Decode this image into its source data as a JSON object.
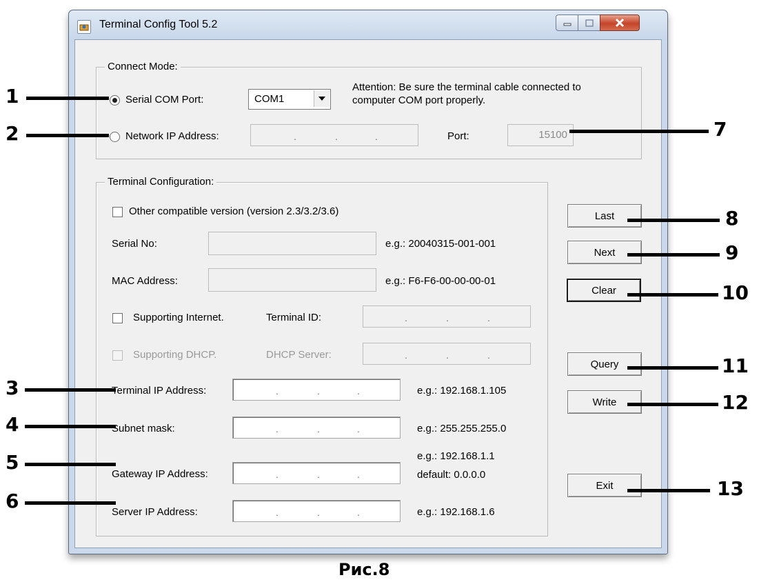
{
  "window": {
    "title": "Terminal Config Tool 5.2"
  },
  "connect_mode": {
    "group_label": "Connect Mode:",
    "serial_label": "Serial COM Port:",
    "com_value": "COM1",
    "attention_line1": "Attention: Be sure the terminal cable connected to",
    "attention_line2": "computer COM port properly.",
    "network_label": "Network IP Address:",
    "port_label": "Port:",
    "port_value": "15100"
  },
  "terminal_config": {
    "group_label": "Terminal Configuration:",
    "other_version_label": "Other compatible version (version 2.3/3.2/3.6)",
    "serial_no_label": "Serial No:",
    "serial_no_example": "e.g.: 20040315-001-001",
    "mac_label": "MAC Address:",
    "mac_example": "e.g.: F6-F6-00-00-00-01",
    "supporting_internet_label": "Supporting Internet.",
    "terminal_id_label": "Terminal ID:",
    "supporting_dhcp_label": "Supporting DHCP.",
    "dhcp_server_label": "DHCP Server:",
    "terminal_ip_label": "Terminal IP Address:",
    "terminal_ip_example": "e.g.: 192.168.1.105",
    "subnet_label": "Subnet mask:",
    "subnet_example": "e.g.: 255.255.255.0",
    "gateway_label": "Gateway IP Address:",
    "gateway_example1": "e.g.: 192.168.1.1",
    "gateway_example2": "default: 0.0.0.0",
    "server_ip_label": "Server IP Address:",
    "server_ip_example": "e.g.: 192.168.1.6"
  },
  "buttons": {
    "last": "Last",
    "next": "Next",
    "clear": "Clear",
    "query": "Query",
    "write": "Write",
    "exit": "Exit"
  },
  "callouts": [
    "1",
    "2",
    "3",
    "4",
    "5",
    "6",
    "7",
    "8",
    "9",
    "10",
    "11",
    "12",
    "13"
  ],
  "caption": "Рис.8"
}
